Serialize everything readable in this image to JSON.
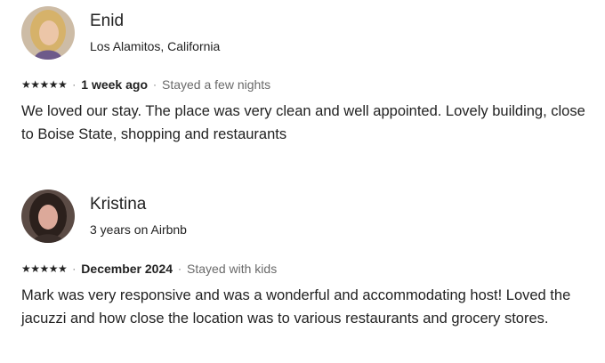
{
  "reviews": [
    {
      "name": "Enid",
      "subtitle": "Los Alamitos, California",
      "rating": 5,
      "stars": "★★★★★",
      "separator": "·",
      "date": "1 week ago",
      "stay_type": "Stayed a few nights",
      "text": "We loved our stay. The place was very clean and well appointed. Lovely building, close to Boise State, shopping and restaurants",
      "avatar_colors": {
        "bg": "#c9b8a0",
        "hair": "#d8b46a",
        "face": "#e9c3a5"
      }
    },
    {
      "name": "Kristina",
      "subtitle": "3 years on Airbnb",
      "rating": 5,
      "stars": "★★★★★",
      "separator": "·",
      "date": "December 2024",
      "stay_type": "Stayed with kids",
      "text": "Mark was very responsive and was a wonderful and accommodating host! Loved the jacuzzi and how close the location was to various restaurants and grocery stores.",
      "avatar_colors": {
        "bg": "#5a4a44",
        "hair": "#2a1f1c",
        "face": "#d9a89a"
      }
    }
  ]
}
